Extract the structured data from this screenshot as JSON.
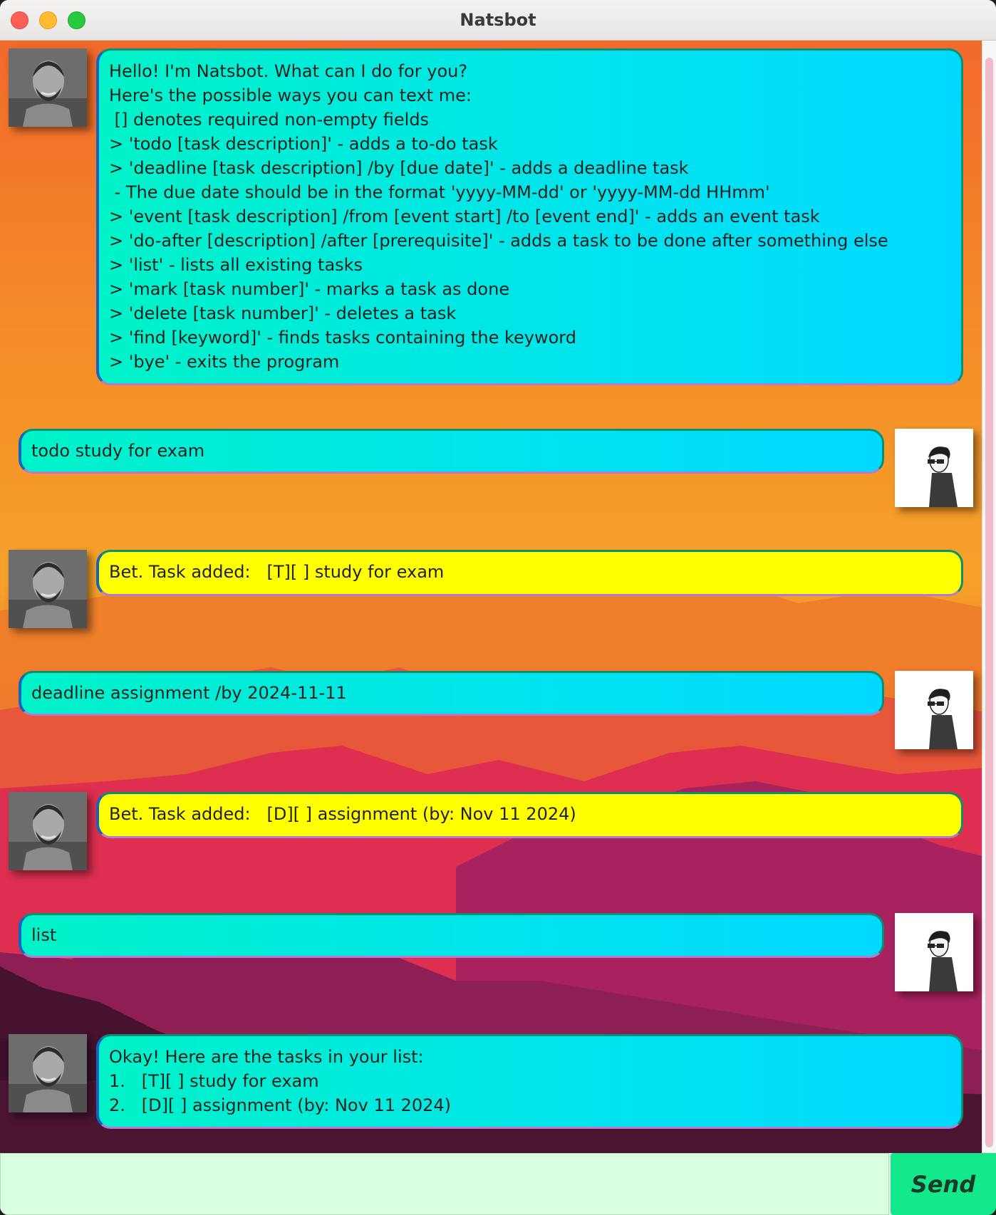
{
  "window": {
    "title": "Natsbot"
  },
  "colors": {
    "bubble_cyan": "#00e3ef",
    "bubble_yellow": "#ffff00",
    "input_bg": "#d9ffe1",
    "send_bg": "#13e88a"
  },
  "icons": {
    "bot_avatar": "bot-avatar-icon",
    "user_avatar": "user-avatar-icon"
  },
  "messages": [
    {
      "sender": "bot",
      "style": "cyan",
      "lines": [
        "Hello! I'm Natsbot. What can I do for you?",
        "Here's the possible ways you can text me:",
        " [] denotes required non-empty fields",
        "> 'todo [task description]' - adds a to-do task",
        "> 'deadline [task description] /by [due date]' - adds a deadline task",
        " - The due date should be in the format 'yyyy-MM-dd' or 'yyyy-MM-dd HHmm'",
        "> 'event [task description] /from [event start] /to [event end]' - adds an event task",
        "> 'do-after [description] /after [prerequisite]' - adds a task to be done after something else",
        "> 'list' - lists all existing tasks",
        "> 'mark [task number]' - marks a task as done",
        "> 'delete [task number]' - deletes a task",
        "> 'find [keyword]' - finds tasks containing the keyword",
        "> 'bye' - exits the program"
      ]
    },
    {
      "sender": "user",
      "style": "cyan",
      "text": "todo study for exam"
    },
    {
      "sender": "bot",
      "style": "yellow",
      "text": "Bet. Task added:   [T][ ] study for exam"
    },
    {
      "sender": "user",
      "style": "cyan",
      "text": "deadline assignment /by 2024-11-11"
    },
    {
      "sender": "bot",
      "style": "yellow",
      "text": "Bet. Task added:   [D][ ] assignment (by: Nov 11 2024)"
    },
    {
      "sender": "user",
      "style": "cyan",
      "text": "list"
    },
    {
      "sender": "bot",
      "style": "cyan",
      "lines": [
        "Okay! Here are the tasks in your list:",
        "1.   [T][ ] study for exam",
        "2.   [D][ ] assignment (by: Nov 11 2024)"
      ]
    }
  ],
  "input": {
    "value": "",
    "placeholder": ""
  },
  "send_button": {
    "label": "Send"
  }
}
